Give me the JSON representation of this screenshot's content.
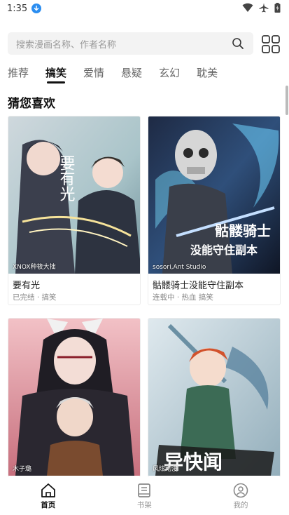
{
  "status_bar": {
    "time": "1:35"
  },
  "search": {
    "placeholder": "搜索漫画名称、作者名称"
  },
  "tabs": [
    {
      "label": "推荐",
      "active": false
    },
    {
      "label": "搞笑",
      "active": true
    },
    {
      "label": "爱情",
      "active": false
    },
    {
      "label": "悬疑",
      "active": false
    },
    {
      "label": "玄幻",
      "active": false
    },
    {
      "label": "耽美",
      "active": false
    }
  ],
  "section": {
    "title": "猜您喜欢"
  },
  "cards": [
    {
      "title": "要有光",
      "meta": "已完结 · 搞笑",
      "author": "XNOX种筱大拙",
      "cover_text": "要有光"
    },
    {
      "title": "骷髅骑士没能守住副本",
      "meta": "连载中 · 热血 搞笑",
      "author": "sosori,Ant Studio",
      "cover_text": "骷髅骑士 没能守住副本"
    },
    {
      "title": "",
      "meta": "",
      "author": "木子璐",
      "cover_text": ""
    },
    {
      "title": "",
      "meta": "",
      "author": "风炫动漫",
      "cover_text": "异快闻"
    }
  ],
  "bottom_nav": [
    {
      "label": "首页",
      "icon": "home-icon",
      "active": true
    },
    {
      "label": "书架",
      "icon": "book-icon",
      "active": false
    },
    {
      "label": "我的",
      "icon": "profile-icon",
      "active": false
    }
  ],
  "colors": {
    "accent": "#111111",
    "status_dot": "#2a8df0",
    "search_bg": "#f3f3f3"
  }
}
